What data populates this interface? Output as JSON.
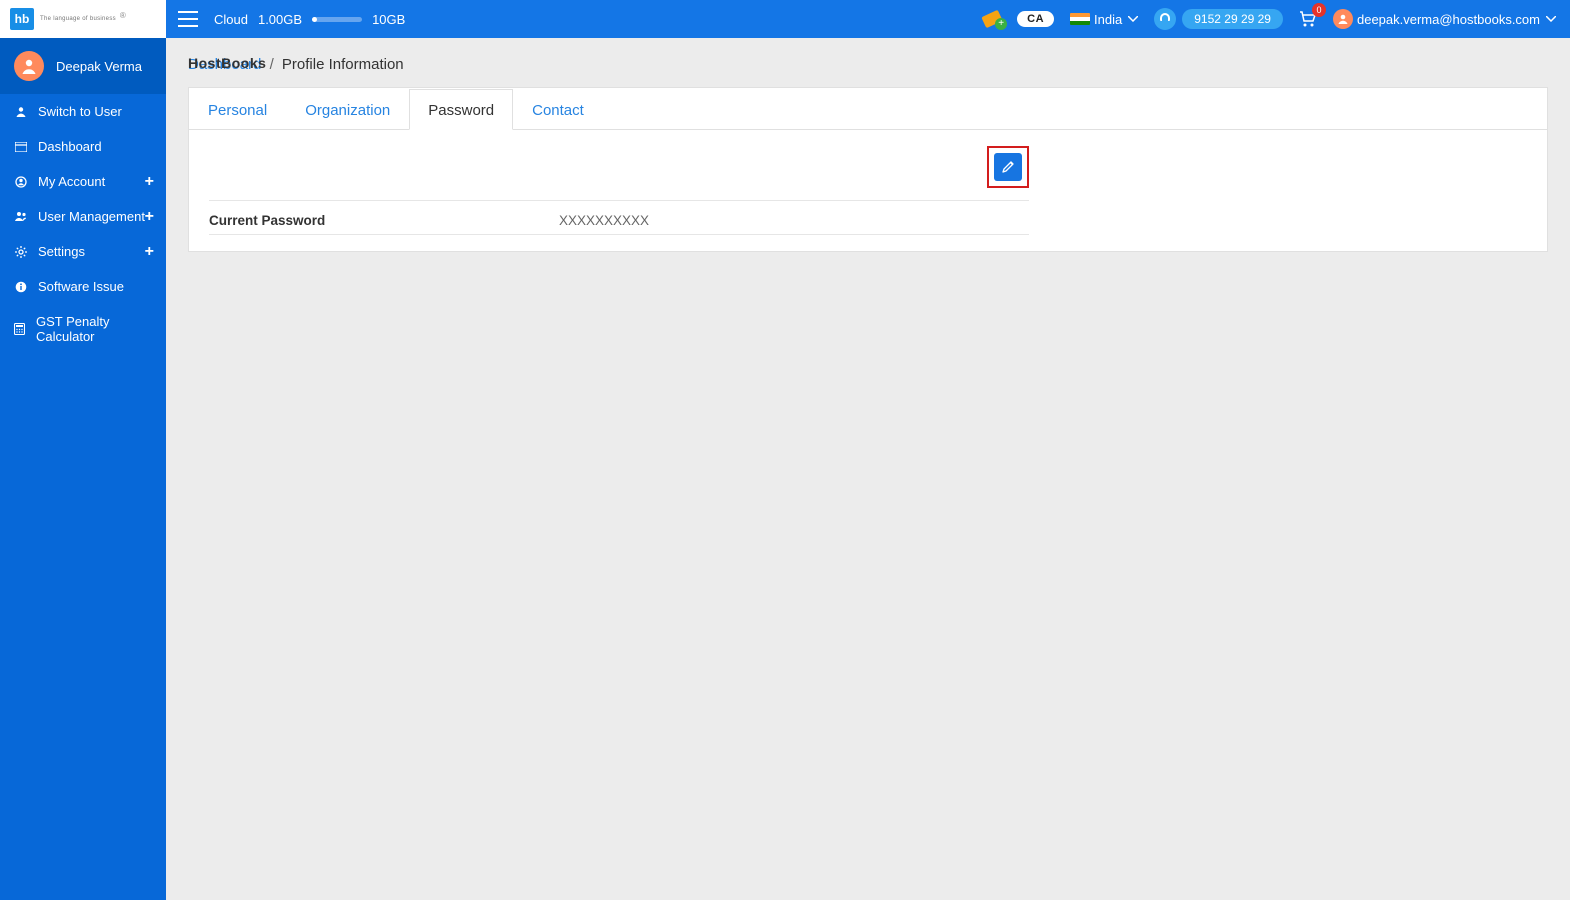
{
  "logo": {
    "badge": "hb",
    "brand": "HostBooks",
    "tagline": "The language of business"
  },
  "topbar": {
    "cloud_label": "Cloud",
    "cloud_used": "1.00GB",
    "cloud_total": "10GB",
    "cloud_fill_pct": 10,
    "country_label": "India",
    "phone": "9152 29 29 29",
    "cart_count": "0",
    "user_email": "deepak.verma@hostbooks.com"
  },
  "sidebar": {
    "user_name": "Deepak Verma",
    "items": [
      {
        "label": "Switch to User",
        "icon": "user",
        "expandable": false
      },
      {
        "label": "Dashboard",
        "icon": "dash",
        "expandable": false
      },
      {
        "label": "My Account",
        "icon": "account",
        "expandable": true
      },
      {
        "label": "User Management",
        "icon": "users",
        "expandable": true
      },
      {
        "label": "Settings",
        "icon": "gear",
        "expandable": true
      },
      {
        "label": "Software Issue",
        "icon": "info",
        "expandable": false
      },
      {
        "label": "GST Penalty Calculator",
        "icon": "calc",
        "expandable": false
      }
    ]
  },
  "breadcrumb": {
    "root": "Dashboard",
    "sep": "/",
    "current": "Profile Information"
  },
  "tabs": [
    {
      "label": "Personal",
      "active": false
    },
    {
      "label": "Organization",
      "active": false
    },
    {
      "label": "Password",
      "active": true
    },
    {
      "label": "Contact",
      "active": false
    }
  ],
  "password_panel": {
    "field_label": "Current Password",
    "field_value": "XXXXXXXXXX"
  }
}
